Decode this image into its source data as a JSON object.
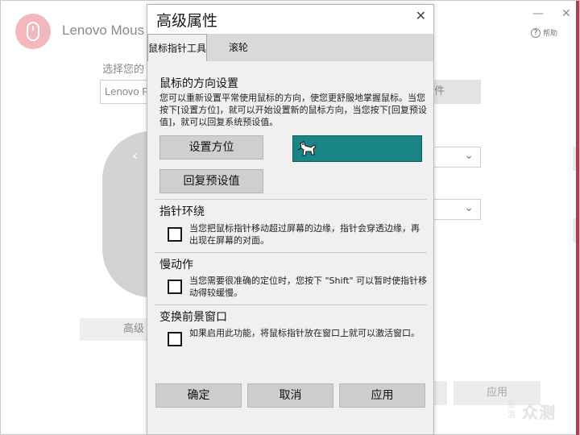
{
  "app": {
    "title": "Lenovo Mous",
    "help_label": "帮助",
    "help_icon_glyph": "?",
    "select_label": "选择您的",
    "device_value": "Lenovo P",
    "file_button_fragment": "件",
    "advanced_button_fragment": "高级",
    "apply_ghost_label": "应用",
    "minimize_glyph": "—",
    "close_glyph": "✕",
    "back_arrow_glyph": "‹",
    "dropdown_glyph": "⌄",
    "accent_color": "#b83a48",
    "logo_color": "#f2b8bd"
  },
  "watermark": {
    "small": "新浪",
    "big": "众测"
  },
  "dialog": {
    "title": "高级属性",
    "close_glyph": "✕",
    "tabs": [
      {
        "label": "鼠标指针工具",
        "active": true
      },
      {
        "label": "滚轮",
        "active": false
      }
    ],
    "orientation": {
      "title": "鼠标的方向设置",
      "description": "您可以重新设置平常使用鼠标的方向，使您更舒服地掌握鼠标。当您按下[设置方位]，就可以开始设置新的鼠标方向，当您按下[回复预设值]，就可以回复系统预设值。",
      "set_button": "设置方位",
      "reset_button": "回复预设值",
      "preview_color": "#1a8586",
      "preview_icon": "dog-cursor-icon"
    },
    "pointer_wrap": {
      "title": "指针环绕",
      "description": "当您把鼠标指针移动超过屏幕的边缘，指针会穿透边缘，再出现在屏幕的对面。",
      "checked": false
    },
    "slow_motion": {
      "title": "慢动作",
      "description": "当您需要很准确的定位时，您按下 \"Shift\" 可以暂时使指针移动得较缓慢。",
      "checked": false
    },
    "foreground": {
      "title": "变换前景窗口",
      "description": "如果启用此功能，将鼠标指针放在窗口上就可以激活窗口。",
      "checked": false
    },
    "footer": {
      "ok": "确定",
      "cancel": "取消",
      "apply": "应用"
    }
  }
}
